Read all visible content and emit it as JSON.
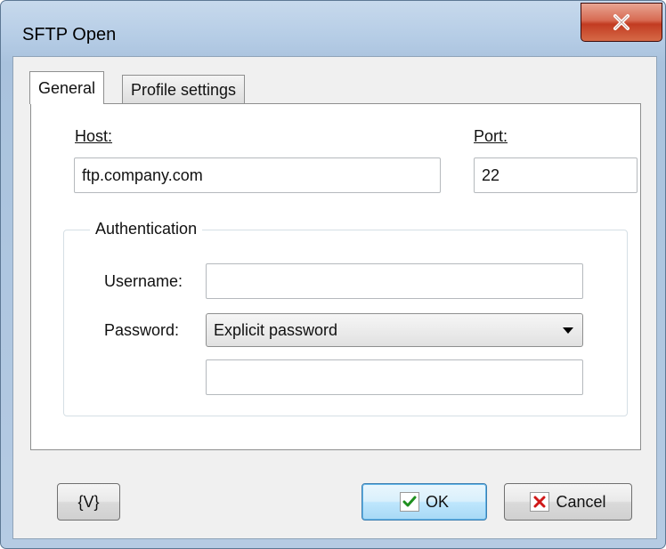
{
  "window": {
    "title": "SFTP Open",
    "close_glyph": "X"
  },
  "tabs": [
    {
      "label": "General",
      "active": true
    },
    {
      "label": "Profile settings",
      "active": false
    }
  ],
  "general": {
    "host_label": "Host:",
    "host_value": "ftp.company.com",
    "port_label": "Port:",
    "port_value": "22",
    "authentication": {
      "legend": "Authentication",
      "username_label": "Username:",
      "username_value": "",
      "password_label": "Password:",
      "password_mode": "Explicit password",
      "password_value": ""
    }
  },
  "buttons": {
    "variables": "{V}",
    "ok": "OK",
    "cancel": "Cancel"
  },
  "colors": {
    "ok_check": "#1f8f1f",
    "cancel_x": "#d01818"
  },
  "icons": {
    "ok": "green-checkmark-icon",
    "cancel": "red-x-icon",
    "close": "close-icon"
  }
}
